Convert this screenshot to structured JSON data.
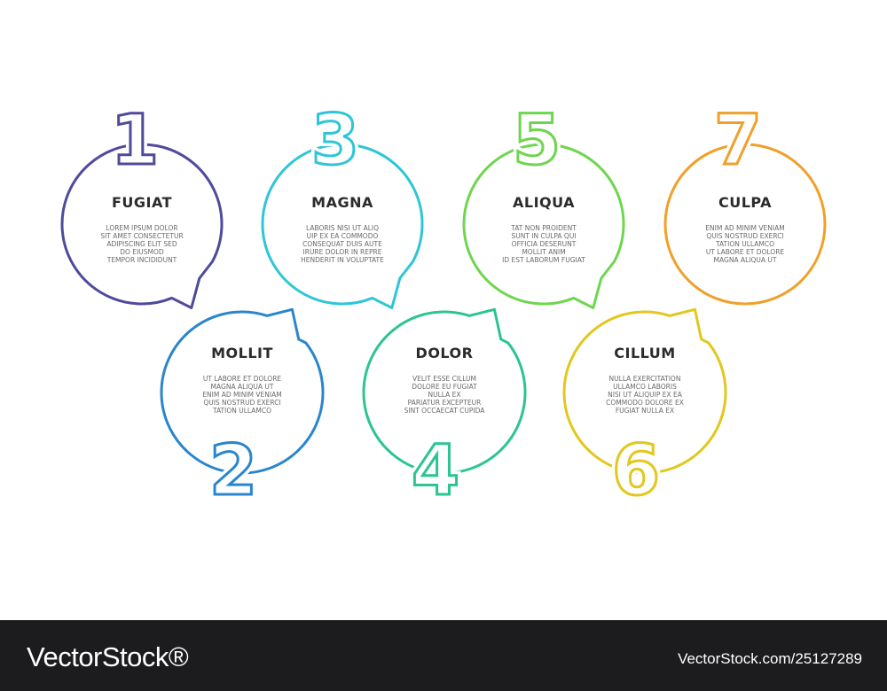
{
  "steps": [
    {
      "number": "1",
      "title": "FUGIAT",
      "color": "#4f4a9a",
      "lines": [
        "LOREM IPSUM DOLOR",
        "SIT AMET CONSECTETUR",
        "ADIPISCING ELIT SED",
        "DO EIUSMOD",
        "TEMPOR INCIDIDUNT"
      ]
    },
    {
      "number": "2",
      "title": "MOLLIT",
      "color": "#2a86cc",
      "lines": [
        "UT LABORE ET DOLORE",
        "MAGNA ALIQUA UT",
        "ENIM AD MINIM VENIAM",
        "QUIS NOSTRUD EXERCI",
        "TATION ULLAMCO"
      ]
    },
    {
      "number": "3",
      "title": "MAGNA",
      "color": "#2ec6d6",
      "lines": [
        "LABORIS NISI UT ALIQ",
        "UIP EX EA COMMODO",
        "CONSEQUAT DUIS AUTE",
        "IRURE DOLOR IN REPRE",
        "HENDERIT IN VOLUPTATE"
      ]
    },
    {
      "number": "4",
      "title": "DOLOR",
      "color": "#2cc493",
      "lines": [
        "VELIT ESSE CILLUM",
        "DOLORE EU FUGIAT",
        "NULLA EX",
        "PARIATUR EXCEPTEUR",
        "SINT OCCAECAT CUPIDA"
      ]
    },
    {
      "number": "5",
      "title": "ALIQUA",
      "color": "#6ed64e",
      "lines": [
        "TAT NON PROIDENT",
        "SUNT IN CULPA QUI",
        "OFFICIA DESERUNT",
        "MOLLIT ANIM",
        "ID EST LABORUM FUGIAT"
      ]
    },
    {
      "number": "6",
      "title": "CILLUM",
      "color": "#e2c71c",
      "lines": [
        "NULLA EXERCITATION",
        "ULLAMCO LABORIS",
        "NISI UT ALIQUIP EX EA",
        "COMMODO DOLORE EX",
        "FUGIAT NULLA EX"
      ]
    },
    {
      "number": "7",
      "title": "CULPA",
      "color": "#f0a02a",
      "lines": [
        "ENIM AD MINIM VENIAM",
        "QUIS NOSTRUD EXERCI",
        "TATION ULLAMCO",
        "UT LABORE ET DOLORE",
        "MAGNA ALIQUA UT"
      ]
    }
  ],
  "footer": {
    "brand": "VectorStock®",
    "image_id": "VectorStock.com/25127289"
  }
}
